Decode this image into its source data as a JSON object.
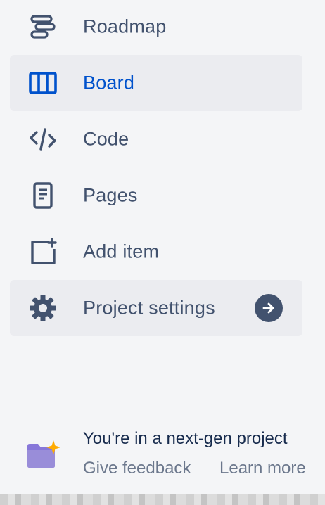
{
  "nav": {
    "items": [
      {
        "label": "Roadmap",
        "icon": "roadmap-icon",
        "state": "default"
      },
      {
        "label": "Board",
        "icon": "board-icon",
        "state": "selected"
      },
      {
        "label": "Code",
        "icon": "code-icon",
        "state": "default"
      },
      {
        "label": "Pages",
        "icon": "pages-icon",
        "state": "default"
      },
      {
        "label": "Add item",
        "icon": "add-item-icon",
        "state": "default"
      },
      {
        "label": "Project settings",
        "icon": "gear-icon",
        "state": "hovered"
      }
    ]
  },
  "footer": {
    "title": "You're in a next-gen project",
    "give_feedback": "Give feedback",
    "learn_more": "Learn more",
    "icon": "sparkle-folder-icon"
  },
  "colors": {
    "background": "#F4F5F7",
    "selected_bg": "#EBECF0",
    "text": "#42526E",
    "accent": "#0052CC",
    "muted": "#6B778C",
    "folder": "#8777D9",
    "sparkle": "#FFAB00"
  }
}
